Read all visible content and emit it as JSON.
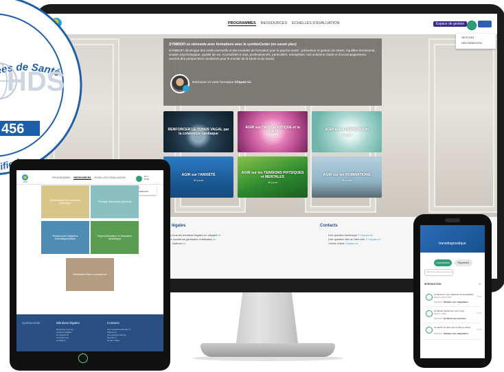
{
  "badge": {
    "top_text": "Données de Santé",
    "initials": "HDS",
    "number": "456",
    "bottom_text": "ified"
  },
  "monitor": {
    "logo": "DAP",
    "menu": [
      "PROGRAMMES",
      "RESSOURCES",
      "ÉCHELLES D'ÉVALUATION"
    ],
    "espace_button": "Espace de gestion",
    "dropdown": [
      "GESTION",
      "DÉCONNEXION"
    ],
    "intro": {
      "title": "SYMBIOFI se réinvente avec formations avec le symbioCenter (en savoir plus)",
      "text": "SYMBIOFI développe des outils interactifs et des modules de formation pour la psycho-santé : prévention et gestion du stress, équilibre émotionnel, soutien psychologique, qualité de vie. Accessibles à tous, professionnels, particuliers, entreprises, nos solutions d'aide et d'accompagnement ouvrent des perspectives novatrices pour le monde de la santé et du travail.",
      "retrouver": "Retrouver ici votre formation",
      "cliquez": "Cliquez-ici"
    },
    "cards": [
      {
        "title": "RENFORCER LE TONUS VAGAL par la cohérence cardiaque",
        "sub": ""
      },
      {
        "title": "AGIR sur l'AUTO-CRITIQUE et la HONTE",
        "sub": "30 jours"
      },
      {
        "title": "AGIR sur la DÉPRESSION",
        "sub": "30 jours"
      },
      {
        "title": "AGIR sur l'ANXIÉTÉ",
        "sub": "30 jours"
      },
      {
        "title": "AGIR sur les TENSIONS PHYSIQUES et MENTALES",
        "sub": "30 jours"
      },
      {
        "title": "AGIR sur les RUMINATIONS",
        "sub": "30 jours"
      }
    ],
    "footer": {
      "legal_title": "ions légales",
      "legal_links": [
        {
          "text": "couvrez tous les mentions légales en cliquant",
          "link": "ici"
        },
        {
          "text": "ultez les conditions générales d'utilisation",
          "link": "ici"
        },
        {
          "text": "crédits - Auteurs",
          "link": "ici"
        }
      ],
      "contact_title": "Contacts",
      "contact_links": [
        {
          "text": "Une question technique ?",
          "link": "Cliquez-ici"
        },
        {
          "text": "Une question liée au bien-être ?",
          "link": "Cliquez-ici"
        },
        {
          "text": "Centre d'aide",
          "link": "Cliquez-ici"
        }
      ]
    }
  },
  "tablet": {
    "logo": "DAP",
    "menu": [
      "PROGRAMMES",
      "RESSOURCES",
      "ÉCHELLES D'ÉVALUATION"
    ],
    "user": [
      "Mr C",
      "Profil"
    ],
    "dropdown": [
      "AIDER",
      "DÉCONNEXION"
    ],
    "tiles": [
      {
        "label": "Biofeedback de cohérence cardiaque",
        "color": "#d8c58a"
      },
      {
        "label": "Thérapie Interactive générale",
        "color": "#8ac0c2"
      },
      {
        "label": "Ressources intégrées transdiagnostique",
        "color": "#4f8cb4"
      },
      {
        "label": "Psychoéducation et relaxation dynamique",
        "color": "#5a9c52"
      },
      {
        "label": "Méditation Pleine conscience",
        "color": "#b49c82"
      }
    ],
    "footer": {
      "brand": "symbiocenter",
      "legal_title": "Mentions légales",
      "contact_title": "Contacts",
      "legal_lines": [
        "Retrouvez tous les",
        "mentions légales",
        "en cliquant ici",
        "Consultez les",
        "conditions"
      ],
      "contact_lines": [
        "Une question technique ?",
        "Cliquez-ici",
        "Une question liée au",
        "bien-être ?",
        "Centre d'aide"
      ]
    }
  },
  "phone": {
    "header": "transdiagnostique",
    "btn_active": "Commencer",
    "btn_other": "Reprendre",
    "search_placeholder": "Rechercher dans ce programme",
    "section": "INTRODUCTION",
    "items": [
      {
        "title": "Je découvre mes capacités de visualisation",
        "sub": "Séance ÉCOUTER",
        "time": "7 min",
        "step": "SÉANCE",
        "label": "Stimuler son imagination"
      },
      {
        "title": "Je débute rapidement mon corps",
        "sub": "Séance LIRE",
        "time": "2 min",
        "step": "SÉANCE",
        "label": "Se libérer des tensions"
      },
      {
        "title": "Je touche un arbre qui me fait se calmer",
        "sub": "",
        "time": "3 min",
        "step": "SÉANCE",
        "label": "Stimuler son imagination"
      }
    ]
  }
}
